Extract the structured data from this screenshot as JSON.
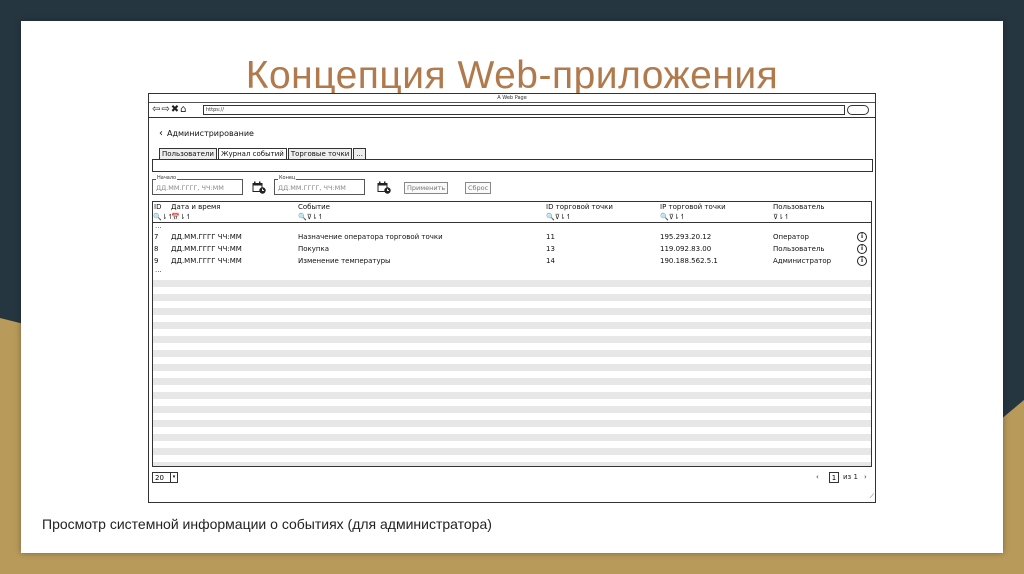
{
  "slide": {
    "title": "Концепция Web-приложения",
    "caption": "Просмотр системной информации о событиях (для администратора)"
  },
  "browser": {
    "window_title": "A Web Page",
    "url": "https://",
    "nav_icons": "⇦⇨✖⌂"
  },
  "page": {
    "back_label": "Администрирование",
    "tabs": [
      "Пользователи",
      "Журнал событий",
      "Торговые точки",
      "..."
    ],
    "active_tab": "Журнал событий",
    "filters": {
      "start_label": "Начало",
      "start_placeholder": "ДД.ММ.ГГГГ, ЧЧ:ММ",
      "end_label": "Конец",
      "end_placeholder": "ДД.ММ.ГГГГ, ЧЧ:ММ",
      "apply_button": "Применить",
      "reset_button": "Сброс"
    },
    "table": {
      "columns": [
        "ID",
        "Дата и время",
        "Событие",
        "ID торговой точки",
        "IP торговой точки",
        "Пользователь"
      ],
      "controls": [
        "🔍⇂↿",
        "📅⇂↿",
        "🔍⊽⇂↿",
        "🔍⊽⇂↿",
        "🔍⊽⇂↿",
        "⊽⇂↿"
      ],
      "ellipsis_top": "...",
      "ellipsis_bottom": "...",
      "rows": [
        [
          "7",
          "ДД.ММ.ГГГГ ЧЧ:ММ",
          "Назначение оператора торговой точки",
          "11",
          "195.293.20.12",
          "Оператор"
        ],
        [
          "8",
          "ДД.ММ.ГГГГ ЧЧ:ММ",
          "Покупка",
          "13",
          "119.092.83.00",
          "Пользователь"
        ],
        [
          "9",
          "ДД.ММ.ГГГГ ЧЧ:ММ",
          "Изменение температуры",
          "14",
          "190.188.562.5.1",
          "Администратор"
        ]
      ],
      "info_icon": "i"
    },
    "pager": {
      "page_size": "20",
      "prev": "‹",
      "current_page": "1",
      "of_label": "из 1",
      "next": "›"
    }
  },
  "colors": {
    "background_dark": "#263641",
    "background_gold": "#b89a5a",
    "title_color": "#b07a4d"
  }
}
